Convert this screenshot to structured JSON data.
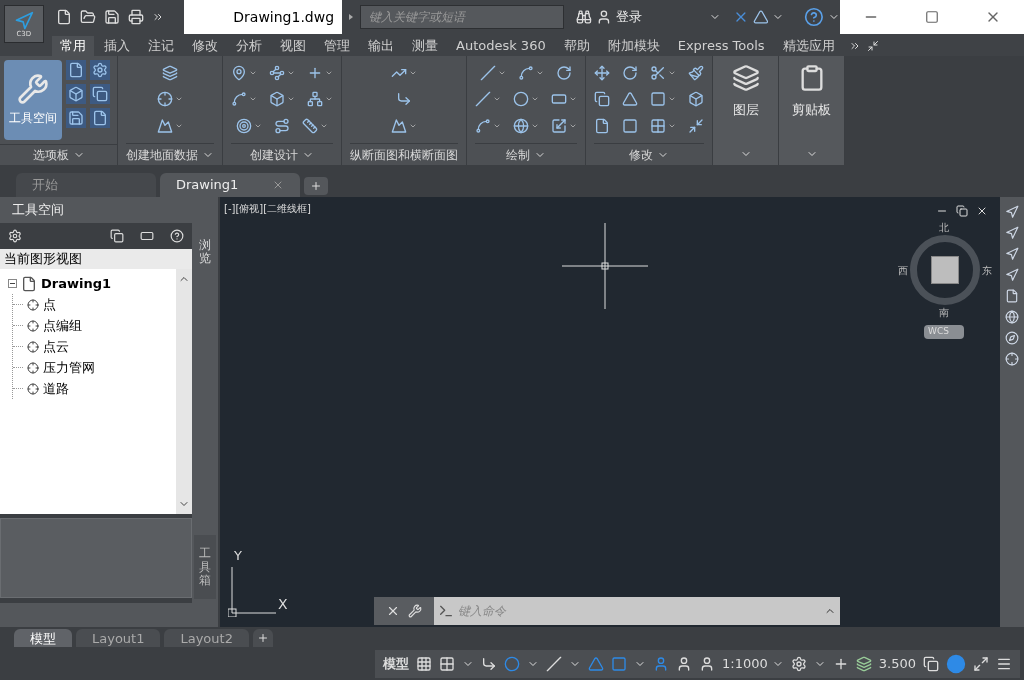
{
  "app_button": {
    "label": "C3D"
  },
  "document_title": "Drawing1.dwg",
  "search": {
    "placeholder": "键入关键字或短语"
  },
  "sign_in": "登录",
  "ribbon_tabs": [
    {
      "label": "常用",
      "selected": true
    },
    {
      "label": "插入",
      "selected": false
    },
    {
      "label": "注记",
      "selected": false
    },
    {
      "label": "修改",
      "selected": false
    },
    {
      "label": "分析",
      "selected": false
    },
    {
      "label": "视图",
      "selected": false
    },
    {
      "label": "管理",
      "selected": false
    },
    {
      "label": "输出",
      "selected": false
    },
    {
      "label": "测量",
      "selected": false
    },
    {
      "label": "Autodesk 360",
      "selected": false
    },
    {
      "label": "帮助",
      "selected": false
    },
    {
      "label": "附加模块",
      "selected": false
    },
    {
      "label": "Express Tools",
      "selected": false
    },
    {
      "label": "精选应用",
      "selected": false
    }
  ],
  "panels": [
    {
      "kind": "palette",
      "title": "选项板",
      "big_tool": "工具空间"
    },
    {
      "kind": "tools",
      "title": "创建地面数据"
    },
    {
      "kind": "tools",
      "title": "创建设计"
    },
    {
      "kind": "tools",
      "title": "纵断面图和横断面图"
    },
    {
      "kind": "tools",
      "title": "绘制"
    },
    {
      "kind": "tools",
      "title": "修改"
    },
    {
      "kind": "big",
      "big_tool": "图层"
    },
    {
      "kind": "big",
      "big_tool": "剪贴板"
    }
  ],
  "doc_tabs": [
    {
      "label": "开始",
      "selected": false
    },
    {
      "label": "Drawing1",
      "selected": true
    }
  ],
  "toolspace": {
    "title": "工具空间",
    "view_selector": "当前图形视图",
    "tree": {
      "label": "Drawing1",
      "expanded": true,
      "children": [
        {
          "label": "点"
        },
        {
          "label": "点编组"
        },
        {
          "label": "点云"
        },
        {
          "label": "压力管网"
        },
        {
          "label": "道路"
        }
      ]
    },
    "side_tabs": [
      {
        "label": "浏览",
        "selected": true
      },
      {
        "label": "工具箱",
        "selected": false
      }
    ]
  },
  "viewport": {
    "label": "[-][俯视][二维线框]",
    "compass": {
      "north": "北",
      "west": "西",
      "east": "东",
      "south": "南",
      "ucs": "WCS"
    },
    "axes": {
      "x": "X",
      "y": "Y"
    }
  },
  "command_line": {
    "placeholder": "键入命令"
  },
  "layout_tabs": [
    {
      "label": "模型",
      "selected": true
    },
    {
      "label": "Layout1",
      "selected": false
    },
    {
      "label": "Layout2",
      "selected": false
    }
  ],
  "status_bar": {
    "model": "模型",
    "scale": "1:1000",
    "annotation_scale": "3.500"
  }
}
